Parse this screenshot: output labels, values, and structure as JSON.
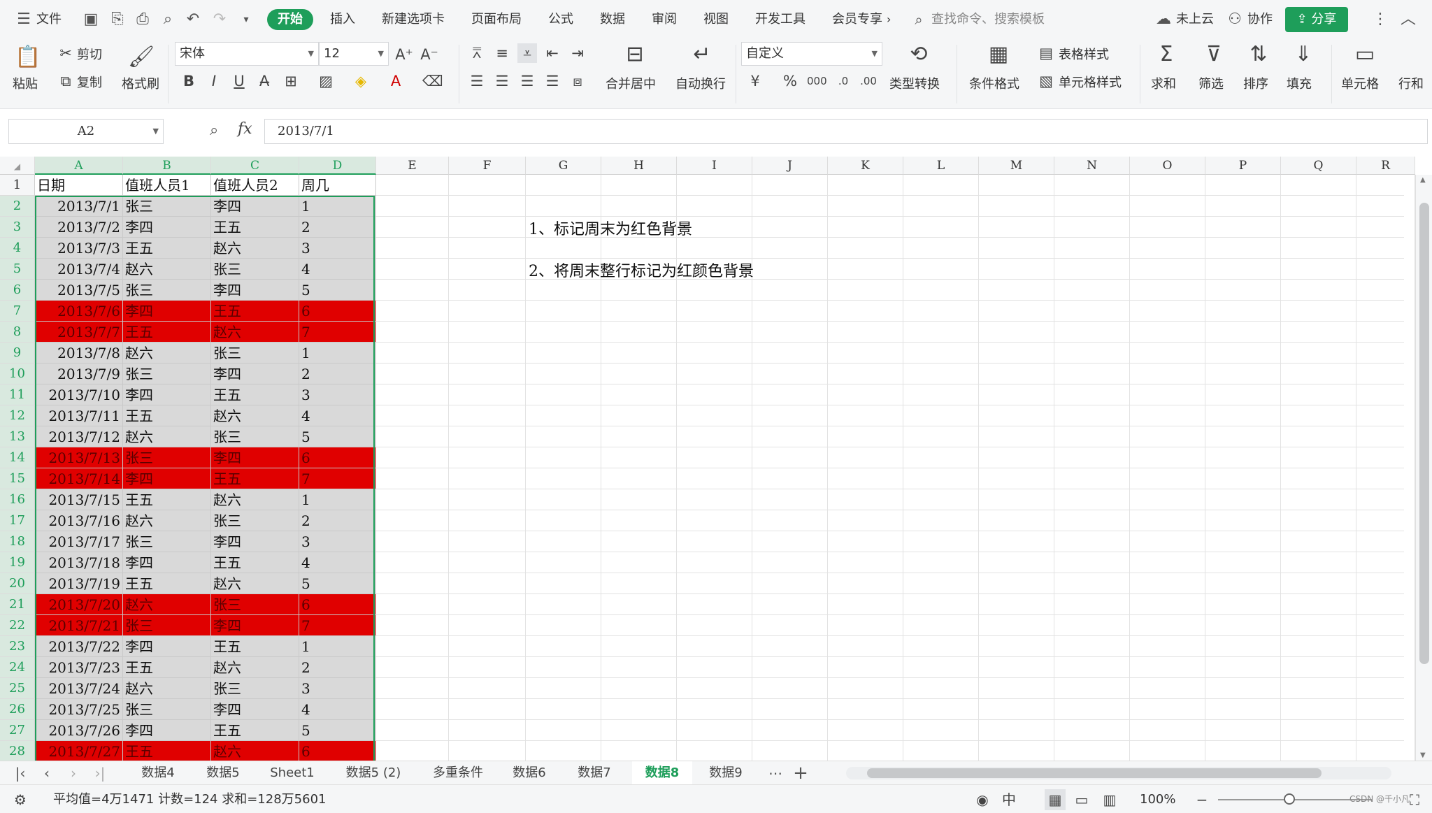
{
  "menubar": {
    "file": "文件",
    "tabs": [
      "开始",
      "插入",
      "新建选项卡",
      "页面布局",
      "公式",
      "数据",
      "审阅",
      "视图",
      "开发工具",
      "会员专享"
    ],
    "search_placeholder": "查找命令、搜索模板",
    "cloud": "未上云",
    "collab": "协作",
    "share": "分享"
  },
  "ribbon": {
    "paste": "粘贴",
    "cut": "剪切",
    "copy": "复制",
    "format_painter": "格式刷",
    "font_name": "宋体",
    "font_size": "12",
    "merge_center": "合并居中",
    "auto_wrap": "自动换行",
    "number_format": "自定义",
    "type_convert": "类型转换",
    "cond_format": "条件格式",
    "table_style": "表格样式",
    "cell_style": "单元格样式",
    "sum": "求和",
    "filter": "筛选",
    "sort": "排序",
    "fill": "填充",
    "cell": "单元格",
    "row_col": "行和"
  },
  "formula": {
    "cell_ref": "A2",
    "fx": "fx",
    "value": "2013/7/1"
  },
  "columns": [
    "A",
    "B",
    "C",
    "D",
    "E",
    "F",
    "G",
    "H",
    "I",
    "J",
    "K",
    "L",
    "M",
    "N",
    "O",
    "P",
    "Q",
    "R"
  ],
  "header_row": [
    "日期",
    "值班人员1",
    "值班人员2",
    "周几"
  ],
  "rows": [
    [
      "2013/7/1",
      "张三",
      "李四",
      "1"
    ],
    [
      "2013/7/2",
      "李四",
      "王五",
      "2"
    ],
    [
      "2013/7/3",
      "王五",
      "赵六",
      "3"
    ],
    [
      "2013/7/4",
      "赵六",
      "张三",
      "4"
    ],
    [
      "2013/7/5",
      "张三",
      "李四",
      "5"
    ],
    [
      "2013/7/6",
      "李四",
      "王五",
      "6"
    ],
    [
      "2013/7/7",
      "王五",
      "赵六",
      "7"
    ],
    [
      "2013/7/8",
      "赵六",
      "张三",
      "1"
    ],
    [
      "2013/7/9",
      "张三",
      "李四",
      "2"
    ],
    [
      "2013/7/10",
      "李四",
      "王五",
      "3"
    ],
    [
      "2013/7/11",
      "王五",
      "赵六",
      "4"
    ],
    [
      "2013/7/12",
      "赵六",
      "张三",
      "5"
    ],
    [
      "2013/7/13",
      "张三",
      "李四",
      "6"
    ],
    [
      "2013/7/14",
      "李四",
      "王五",
      "7"
    ],
    [
      "2013/7/15",
      "王五",
      "赵六",
      "1"
    ],
    [
      "2013/7/16",
      "赵六",
      "张三",
      "2"
    ],
    [
      "2013/7/17",
      "张三",
      "李四",
      "3"
    ],
    [
      "2013/7/18",
      "李四",
      "王五",
      "4"
    ],
    [
      "2013/7/19",
      "王五",
      "赵六",
      "5"
    ],
    [
      "2013/7/20",
      "赵六",
      "张三",
      "6"
    ],
    [
      "2013/7/21",
      "张三",
      "李四",
      "7"
    ],
    [
      "2013/7/22",
      "李四",
      "王五",
      "1"
    ],
    [
      "2013/7/23",
      "王五",
      "赵六",
      "2"
    ],
    [
      "2013/7/24",
      "赵六",
      "张三",
      "3"
    ],
    [
      "2013/7/25",
      "张三",
      "李四",
      "4"
    ],
    [
      "2013/7/26",
      "李四",
      "王五",
      "5"
    ],
    [
      "2013/7/27",
      "王五",
      "赵六",
      "6"
    ]
  ],
  "notes": [
    "1、标记周末为红色背景",
    "2、将周末整行标记为红颜色背景"
  ],
  "sheet_tabs": [
    "数据4",
    "数据5",
    "Sheet1",
    "数据5 (2)",
    "多重条件",
    "数据6",
    "数据7",
    "数据8",
    "数据9"
  ],
  "active_sheet": "数据8",
  "status": {
    "summary": "平均值=4万1471  计数=124  求和=128万5601",
    "zoom": "100%",
    "watermark": "CSDN @千小凡"
  },
  "colors": {
    "accent": "#1e9e5a",
    "weekend": "#e00000",
    "data_fill": "#d9d9d9"
  }
}
